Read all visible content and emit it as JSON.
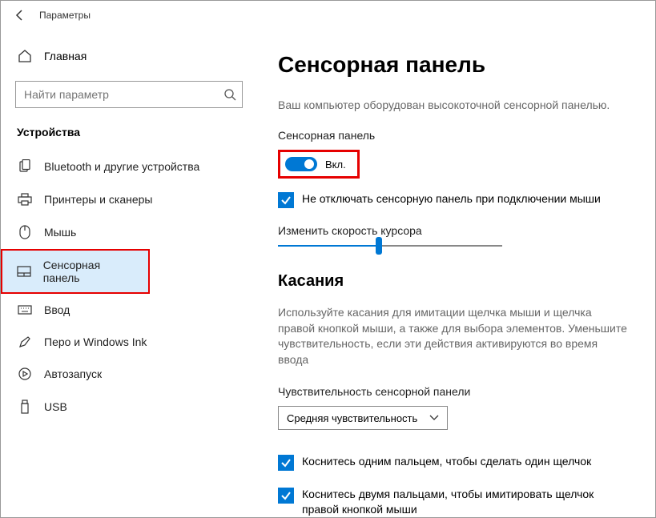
{
  "titlebar": {
    "title": "Параметры"
  },
  "sidebar": {
    "home": "Главная",
    "search_placeholder": "Найти параметр",
    "section": "Устройства",
    "items": [
      {
        "label": "Bluetooth и другие устройства"
      },
      {
        "label": "Принтеры и сканеры"
      },
      {
        "label": "Мышь"
      },
      {
        "label": "Сенсорная панель"
      },
      {
        "label": "Ввод"
      },
      {
        "label": "Перо и Windows Ink"
      },
      {
        "label": "Автозапуск"
      },
      {
        "label": "USB"
      }
    ]
  },
  "main": {
    "title": "Сенсорная панель",
    "description": "Ваш компьютер оборудован высокоточной сенсорной панелью.",
    "touchpad_label": "Сенсорная панель",
    "toggle_state": "Вкл.",
    "keep_on_mouse": "Не отключать сенсорную панель при подключении мыши",
    "cursor_speed_label": "Изменить скорость курсора",
    "slider_percent": 45,
    "touches_heading": "Касания",
    "touches_desc": "Используйте касания для имитации щелчка мыши и щелчка правой кнопкой мыши, а также для выбора элементов. Уменьшите чувствительность, если эти действия активируются во время ввода",
    "sensitivity_label": "Чувствительность сенсорной панели",
    "sensitivity_value": "Средняя чувствительность",
    "tap_single": "Коснитесь одним пальцем, чтобы сделать один щелчок",
    "tap_double": "Коснитесь двумя пальцами, чтобы имитировать щелчок правой кнопкой мыши"
  }
}
